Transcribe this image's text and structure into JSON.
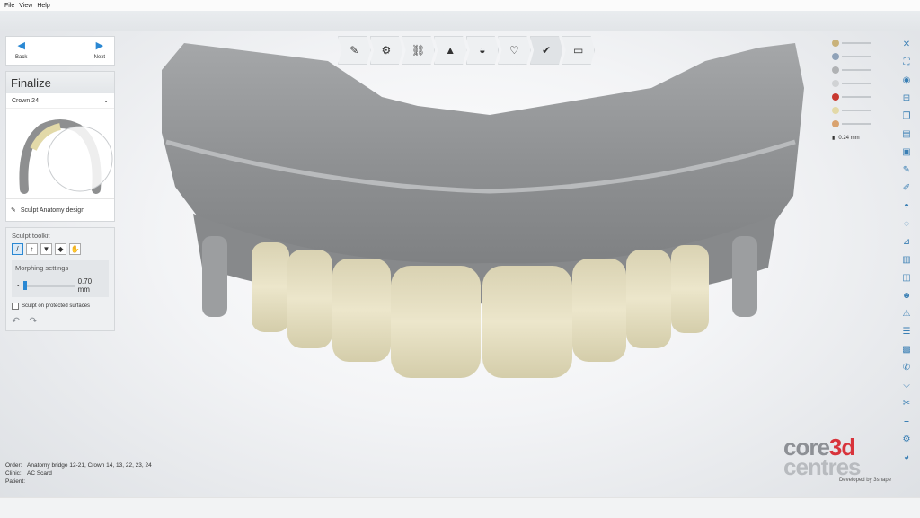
{
  "menu": {
    "items": [
      "File",
      "View",
      "Help"
    ]
  },
  "nav": {
    "back": "Back",
    "next": "Next"
  },
  "step": {
    "title": "Finalize",
    "crown": "Crown 24",
    "sculpt_label": "Sculpt Anatomy design"
  },
  "toolkit": {
    "title": "Sculpt toolkit",
    "morph_title": "Morphing settings",
    "morph_value": "0.70 mm",
    "protected_label": "Sculpt on protected surfaces"
  },
  "right_controls": {
    "thickness": "0.24 mm"
  },
  "info": {
    "order_label": "Order:",
    "order_value": "Anatomy bridge 12-21, Crown 14, 13, 22, 23, 24",
    "clinic_label": "Clinic:",
    "clinic_value": "AC Scard",
    "patient_label": "Patient:",
    "patient_value": ""
  },
  "logo": {
    "word1a": "core",
    "word1b": "3d",
    "word2": "centres",
    "developed": "Developed by 3shape"
  },
  "icons": {
    "toolbar": [
      "margin-icon",
      "crown-icon",
      "connector-icon",
      "gingiva-icon",
      "pontic-icon",
      "anatomy-icon",
      "finalize-icon",
      "export-icon"
    ],
    "right": [
      "close-icon",
      "fullscreen-icon",
      "camera-icon",
      "section-icon",
      "copy-icon",
      "layer-icon",
      "cube-icon",
      "brush-icon",
      "wax-icon",
      "morph-icon",
      "smooth-icon",
      "measure-icon",
      "library-icon",
      "teeth-icon",
      "face-icon",
      "warning-icon",
      "notes-icon",
      "photo-icon",
      "chat-icon",
      "gingiva-icon",
      "scissors-icon",
      "ruler-icon",
      "settings-icon",
      "color-icon"
    ]
  },
  "colors": {
    "accent": "#2a88d3",
    "tooth": "#e7e1c4",
    "gum": "#8f9193",
    "logo_red": "#d8333b"
  }
}
